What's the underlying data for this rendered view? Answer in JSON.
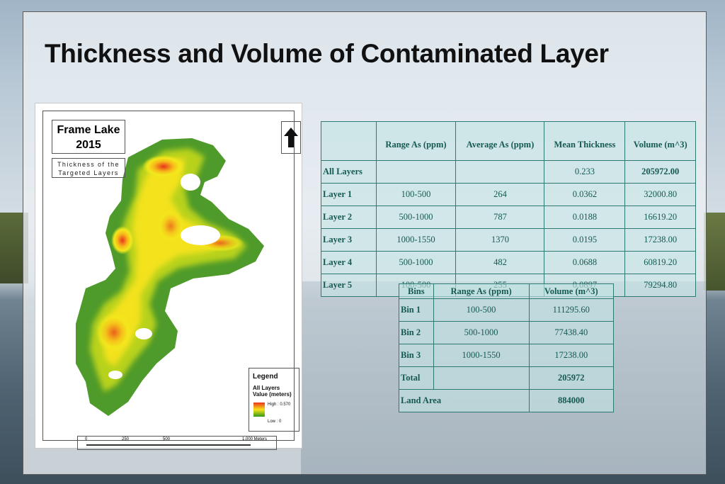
{
  "title": "Thickness and Volume of Contaminated Layer",
  "map": {
    "title_line1": "Frame Lake",
    "title_line2": "2015",
    "subtitle_line1": "Thickness of the",
    "subtitle_line2": "Targeted Layers",
    "legend_title": "Legend",
    "legend_layer": "All Layers",
    "legend_value": "Value (meters)",
    "legend_high": "High : 0.570",
    "legend_low": "Low : 0",
    "scale_labels": [
      "0",
      "250",
      "500",
      "1,000 Meters"
    ]
  },
  "layer_table": {
    "headers": [
      "",
      "Range As (ppm)",
      "Average As (ppm)",
      "Mean Thickness",
      "Volume (m^3)"
    ],
    "rows": [
      [
        "All Layers",
        "",
        "",
        "0.233",
        "205972.00"
      ],
      [
        "Layer 1",
        "100-500",
        "264",
        "0.0362",
        "32000.80"
      ],
      [
        "Layer 2",
        "500-1000",
        "787",
        "0.0188",
        "16619.20"
      ],
      [
        "Layer 3",
        "1000-1550",
        "1370",
        "0.0195",
        "17238.00"
      ],
      [
        "Layer 4",
        "500-1000",
        "482",
        "0.0688",
        "60819.20"
      ],
      [
        "Layer 5",
        "100-500",
        "255",
        "0.0897",
        "79294.80"
      ]
    ]
  },
  "bin_table": {
    "headers": [
      "Bins",
      "Range As (ppm)",
      "Volume (m^3)"
    ],
    "rows": [
      [
        "Bin 1",
        "100-500",
        "111295.60"
      ],
      [
        "Bin 2",
        "500-1000",
        "77438.40"
      ],
      [
        "Bin 3",
        "1000-1550",
        "17238.00"
      ],
      [
        "Total",
        "",
        "205972"
      ]
    ],
    "land_area_label": "Land Area",
    "land_area_value": "884000"
  }
}
